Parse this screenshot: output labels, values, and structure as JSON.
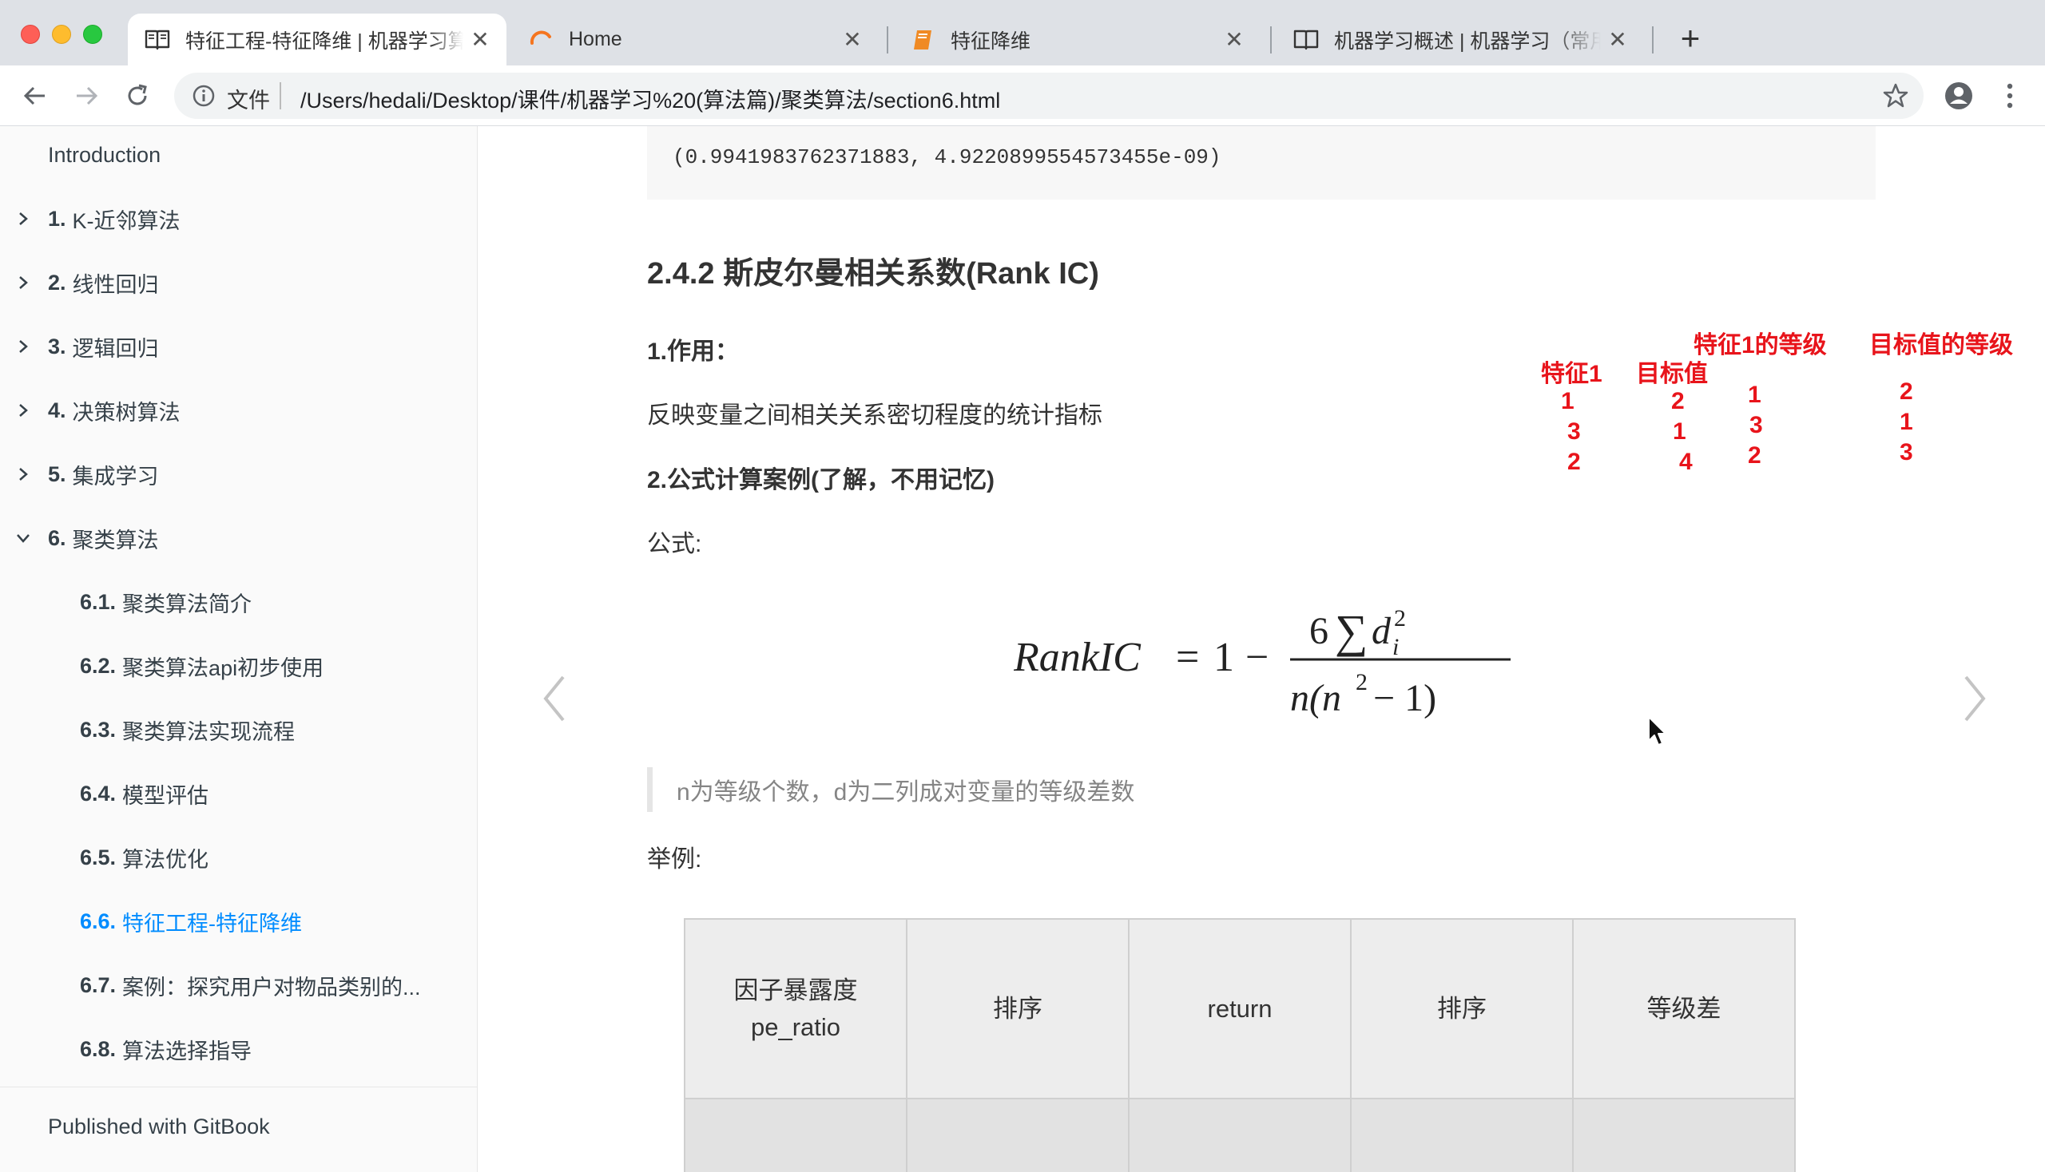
{
  "browser": {
    "tabs": [
      {
        "title": "特征工程-特征降维 | 机器学习算",
        "icon": "book-icon",
        "active": true
      },
      {
        "title": "Home",
        "icon": "loading-spinner-icon",
        "active": false
      },
      {
        "title": "特征降维",
        "icon": "notebook-icon",
        "active": false
      },
      {
        "title": "机器学习概述 | 机器学习（常用",
        "icon": "book-icon",
        "active": false
      }
    ],
    "new_tab_label": "+",
    "close_glyph": "✕",
    "address": {
      "security_label": "文件",
      "url": "/Users/hedali/Desktop/课件/机器学习%20(算法篇)/聚类算法/section6.html"
    }
  },
  "sidebar": {
    "intro": "Introduction",
    "items": [
      {
        "num": "1.",
        "label": "K-近邻算法",
        "expanded": false
      },
      {
        "num": "2.",
        "label": "线性回归",
        "expanded": false
      },
      {
        "num": "3.",
        "label": "逻辑回归",
        "expanded": false
      },
      {
        "num": "4.",
        "label": "决策树算法",
        "expanded": false
      },
      {
        "num": "5.",
        "label": "集成学习",
        "expanded": false
      },
      {
        "num": "6.",
        "label": "聚类算法",
        "expanded": true
      }
    ],
    "subitems": [
      {
        "num": "6.1.",
        "label": "聚类算法简介"
      },
      {
        "num": "6.2.",
        "label": "聚类算法api初步使用"
      },
      {
        "num": "6.3.",
        "label": "聚类算法实现流程"
      },
      {
        "num": "6.4.",
        "label": "模型评估"
      },
      {
        "num": "6.5.",
        "label": "算法优化"
      },
      {
        "num": "6.6.",
        "label": "特征工程-特征降维",
        "active": true
      },
      {
        "num": "6.7.",
        "label": "案例：探究用户对物品类别的..."
      },
      {
        "num": "6.8.",
        "label": "算法选择指导"
      }
    ],
    "footer": "Published with GitBook",
    "active_color": "#008cff"
  },
  "content": {
    "code_output": "(0.9941983762371883, 4.9220899554573455e-09)",
    "heading": "2.4.2 斯皮尔曼相关系数(Rank IC)",
    "purpose_title": "1.作用：",
    "purpose_text": "反映变量之间相关关系密切程度的统计指标",
    "example_title": "2.公式计算案例(了解，不用记忆)",
    "formula_label": "公式:",
    "formula": {
      "lhs": "RankIC",
      "eq": "=",
      "one": "1",
      "minus": "−",
      "numerator_coef": "6",
      "sum": "∑",
      "var": "d",
      "sub": "i",
      "sup": "2",
      "denominator": "n(n",
      "den_sup": "2",
      "den_tail": " − 1)"
    },
    "note": "n为等级个数，d为二列成对变量的等级差数",
    "example_label": "举例:",
    "table": {
      "headers": [
        "因子暴露度\npe_ratio",
        "排序",
        "return",
        "排序",
        "等级差"
      ]
    }
  },
  "annotations": {
    "color": "#e8141b",
    "labels": {
      "feature1": "特征1",
      "target": "目标值",
      "feature1_rank": "特征1的等级",
      "target_rank": "目标值的等级"
    },
    "feature1_values": [
      "1",
      "3",
      "2"
    ],
    "target_values": [
      "2",
      "1",
      "4"
    ],
    "feature1_rank_values": [
      "1",
      "3",
      "2"
    ],
    "target_rank_values": [
      "2",
      "1",
      "3"
    ]
  }
}
